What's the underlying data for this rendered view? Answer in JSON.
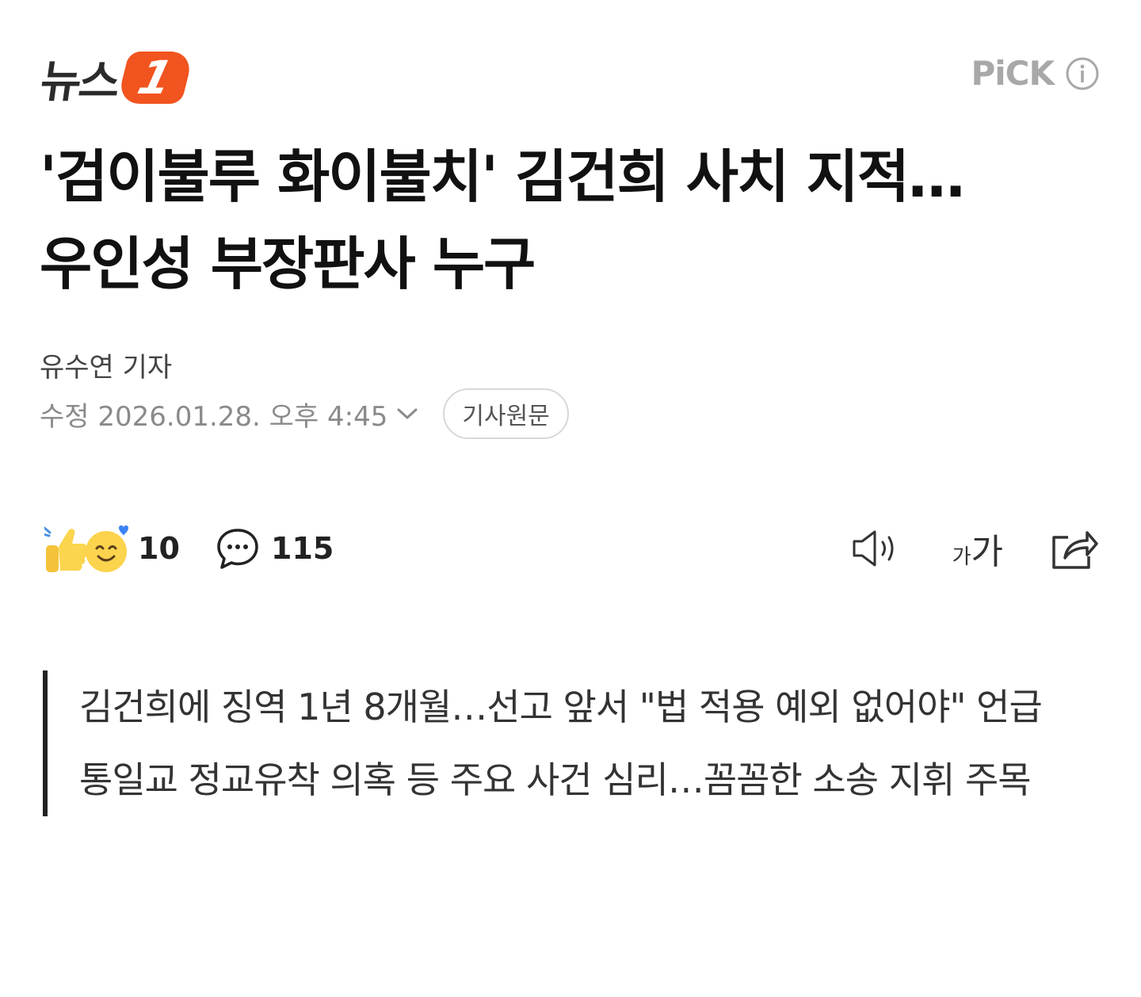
{
  "header": {
    "logo_text": "뉴스",
    "logo_badge": "1",
    "pick_label": "PiCK",
    "info_icon": "info-icon"
  },
  "article": {
    "title_line1": "'검이불루 화이불치' 김건희 사치 지적…",
    "title_line2": "우인성 부장판사 누구",
    "reporter": "유수연 기자",
    "date": "수정 2026.01.28. 오후 4:45",
    "origin_button": "기사원문"
  },
  "toolbar": {
    "reaction_icons": [
      "thumbs-up-icon",
      "smiling-face-with-heart-icon"
    ],
    "reaction_count": "10",
    "comment_icon": "speech-bubble-icon",
    "comment_count": "115",
    "tts_icon": "speaker-icon",
    "font_small": "가",
    "font_large": "가",
    "share_icon": "share-icon"
  },
  "summary": {
    "lines": [
      "김건희에 징역 1년 8개월…선고 앞서 \"법 적용 예외 없어야\" 언급",
      "통일교 정교유착 의혹 등 주요 사건 심리…꼼꼼한 소송 지휘 주목"
    ]
  },
  "colors": {
    "brand": "#f2541f",
    "pick": "#a8a8a8",
    "text": "#111111",
    "muted": "#8a8a8a"
  }
}
